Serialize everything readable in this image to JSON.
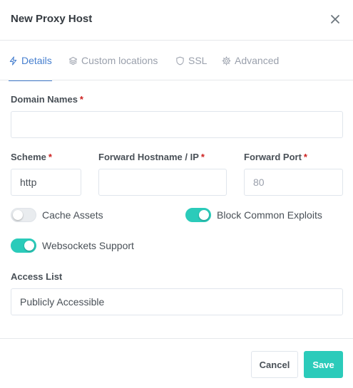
{
  "dialog": {
    "title": "New Proxy Host",
    "close_icon": "close-icon"
  },
  "tabs": [
    {
      "label": "Details",
      "icon": "lightning-icon",
      "active": true
    },
    {
      "label": "Custom locations",
      "icon": "layers-icon",
      "active": false
    },
    {
      "label": "SSL",
      "icon": "shield-icon",
      "active": false
    },
    {
      "label": "Advanced",
      "icon": "gear-icon",
      "active": false
    }
  ],
  "form": {
    "domain_names": {
      "label": "Domain Names",
      "required": "*",
      "value": "",
      "placeholder": ""
    },
    "scheme": {
      "label": "Scheme",
      "required": "*",
      "value": "http"
    },
    "forward_host": {
      "label": "Forward Hostname / IP",
      "required": "*",
      "value": "",
      "placeholder": ""
    },
    "forward_port": {
      "label": "Forward Port",
      "required": "*",
      "value": "",
      "placeholder": "80"
    },
    "cache_assets": {
      "label": "Cache Assets",
      "on": false
    },
    "block_exploits": {
      "label": "Block Common Exploits",
      "on": true
    },
    "websockets": {
      "label": "Websockets Support",
      "on": true
    },
    "access_list": {
      "label": "Access List",
      "value": "Publicly Accessible"
    }
  },
  "footer": {
    "cancel_label": "Cancel",
    "save_label": "Save"
  },
  "colors": {
    "accent": "#467fcf",
    "toggle_on": "#2bcbba",
    "save_button": "#2bcbba",
    "required": "#cd201f"
  }
}
